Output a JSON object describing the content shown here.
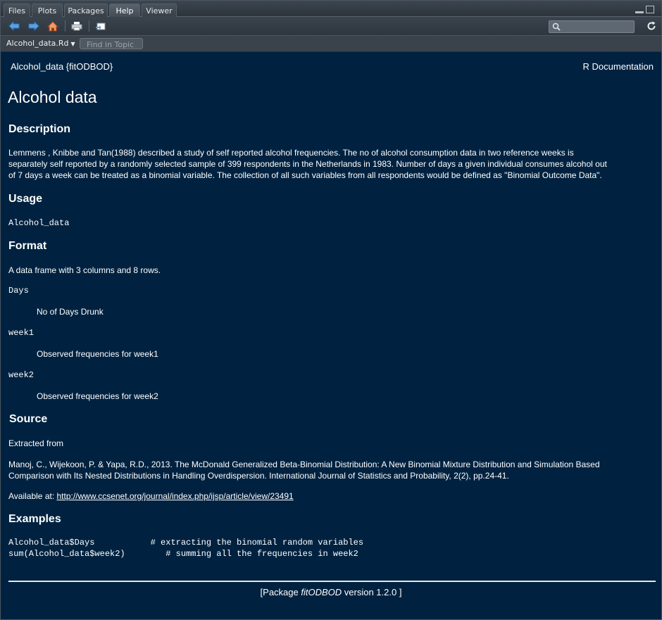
{
  "tabs": [
    {
      "label": "Files"
    },
    {
      "label": "Plots"
    },
    {
      "label": "Packages"
    },
    {
      "label": "Help"
    },
    {
      "label": "Viewer"
    }
  ],
  "topic": {
    "selected": "Alcohol_data.Rd",
    "find_placeholder": "Find in Topic"
  },
  "doc": {
    "header_left": "Alcohol_data {fitODBOD}",
    "header_right": "R Documentation",
    "title": "Alcohol data",
    "description_heading": "Description",
    "description_line1": "Lemmens , Knibbe and Tan(1988) described a study of self reported alcohol frequencies. The no of alcohol consumption data in two reference weeks is",
    "description_line2": "separately self reported by a randomly selected sample of 399 respondents in the Netherlands in 1983. Number of days a given individual consumes alcohol out",
    "description_line3": "of 7 days a week can be treated as a binomial variable. The collection of all such variables from all respondents would be defined as \"Binomial Outcome Data\".",
    "usage_heading": "Usage",
    "usage_code": "Alcohol_data",
    "format_heading": "Format",
    "format_text": "A data frame with 3 columns and 8 rows.",
    "items": [
      {
        "name": "Days",
        "desc": "No of Days Drunk"
      },
      {
        "name": "week1",
        "desc": "Observed frequencies for week1"
      },
      {
        "name": "week2",
        "desc": "Observed frequencies for week2"
      }
    ],
    "source_heading": "Source",
    "source_intro": "Extracted from",
    "source_ref_line1": "Manoj, C., Wijekoon, P. & Yapa, R.D., 2013. The McDonald Generalized Beta-Binomial Distribution: A New Binomial Mixture Distribution and Simulation Based",
    "source_ref_line2": "Comparison with Its Nested Distributions in Handling Overdispersion. International Journal of Statistics and Probability, 2(2), pp.24-41.",
    "available_label": "Available at: ",
    "available_url": "http://www.ccsenet.org/journal/index.php/ijsp/article/view/23491",
    "examples_heading": "Examples",
    "example_line1": "Alcohol_data$Days           # extracting the binomial random variables",
    "example_line2": "sum(Alcohol_data$week2)        # summing all the frequencies in week2",
    "footer_prefix": "[Package ",
    "footer_pkg": "fitODBOD",
    "footer_suffix": " version 1.2.0 ]"
  }
}
